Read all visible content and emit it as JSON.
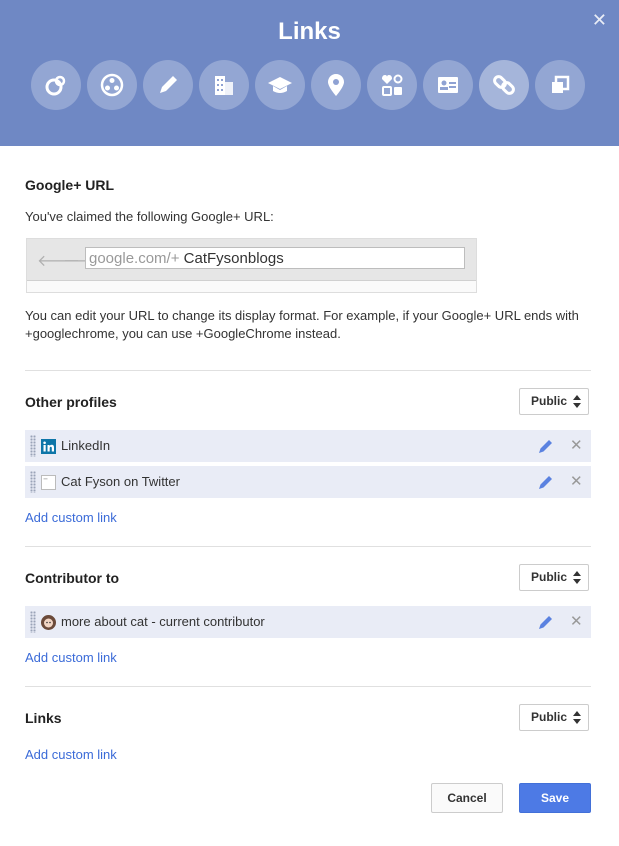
{
  "dialog": {
    "title": "Links",
    "close_glyph": "✕"
  },
  "header_icons": [
    {
      "name": "story-icon"
    },
    {
      "name": "people-icon"
    },
    {
      "name": "pencil-icon"
    },
    {
      "name": "building-icon"
    },
    {
      "name": "graduation-cap-icon"
    },
    {
      "name": "location-pin-icon"
    },
    {
      "name": "gender-icon"
    },
    {
      "name": "contact-card-icon"
    },
    {
      "name": "links-icon",
      "active": true
    },
    {
      "name": "accounts-icon"
    }
  ],
  "google_url": {
    "heading": "Google+ URL",
    "claimed_text": "You've claimed the following Google+ URL:",
    "url_prefix": "google.com/+",
    "url_name": "CatFysonblogs",
    "help_line1": "You can edit your URL to change its display format. For example, if your Google+ URL ends with",
    "help_line2": "+googlechrome, you can use +GoogleChrome instead."
  },
  "other_profiles": {
    "heading": "Other profiles",
    "visibility": "Public",
    "items": [
      {
        "label": "LinkedIn",
        "icon": "linkedin-icon"
      },
      {
        "label": "Cat Fyson on Twitter",
        "icon": "page-icon"
      }
    ],
    "add_link": "Add custom link"
  },
  "contributor_to": {
    "heading": "Contributor to",
    "visibility": "Public",
    "items": [
      {
        "label": "more about cat - current contributor",
        "icon": "avatar-icon"
      }
    ],
    "add_link": "Add custom link"
  },
  "links": {
    "heading": "Links",
    "visibility": "Public",
    "add_link": "Add custom link"
  },
  "footer": {
    "cancel_label": "Cancel",
    "save_label": "Save"
  },
  "colors": {
    "header_bg": "#6f88c4",
    "accent": "#4d7ae5",
    "link": "#3b6bd8",
    "row_bg": "#e9ecf6"
  }
}
